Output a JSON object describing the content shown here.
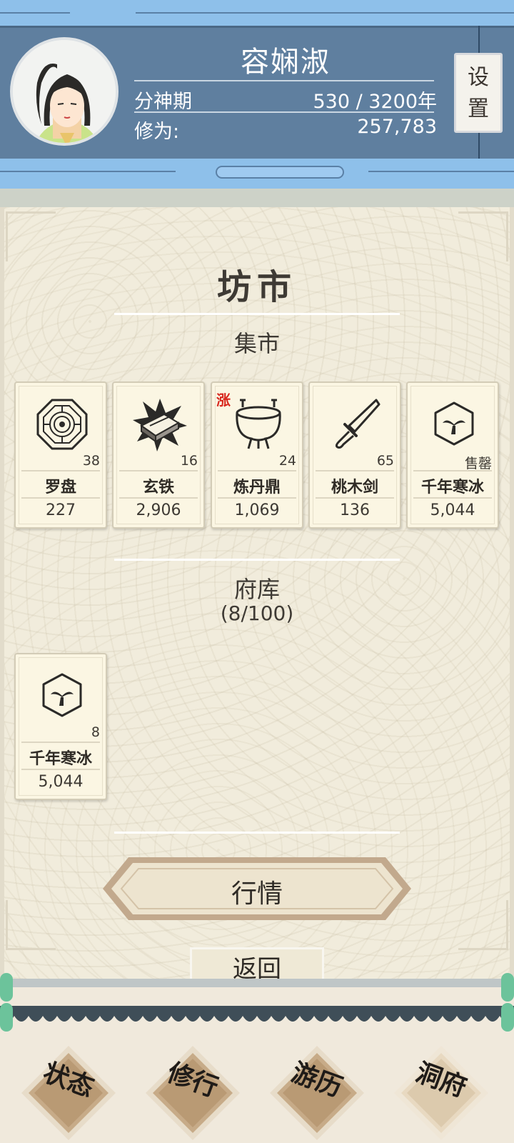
{
  "header": {
    "player_name": "容娴淑",
    "realm": "分神期",
    "lifespan": "530 / 3200年",
    "cultivation_label": "修为:",
    "cultivation_value": "257,783",
    "settings_label_1": "设",
    "settings_label_2": "置"
  },
  "market": {
    "title": "坊市",
    "bazaar_title": "集市",
    "bazaar_items": [
      {
        "name": "罗盘",
        "count": "38",
        "price": "227",
        "icon": "bagua-compass-icon",
        "tag": ""
      },
      {
        "name": "玄铁",
        "count": "16",
        "price": "2,906",
        "icon": "iron-ingot-icon",
        "tag": ""
      },
      {
        "name": "炼丹鼎",
        "count": "24",
        "price": "1,069",
        "icon": "alchemy-cauldron-icon",
        "tag": "涨"
      },
      {
        "name": "桃木剑",
        "count": "65",
        "price": "136",
        "icon": "wooden-sword-icon",
        "tag": ""
      },
      {
        "name": "千年寒冰",
        "count": "售罄",
        "price": "5,044",
        "icon": "ice-hexagon-icon",
        "tag": ""
      }
    ],
    "storage_title": "府库",
    "storage_capacity": "(8/100)",
    "storage_items": [
      {
        "name": "千年寒冰",
        "count": "8",
        "price": "5,044",
        "icon": "ice-hexagon-icon"
      }
    ],
    "quotes_button": "行情",
    "back_button": "返回"
  },
  "nav": {
    "status": "状态",
    "cultivate": "修行",
    "travel": "游历",
    "cave": "洞府"
  },
  "colors": {
    "header_blue": "#5f7f9f",
    "sky_blue": "#8ec0ea",
    "rise_red": "#d8261c",
    "parchment": "#f1ecdc"
  }
}
